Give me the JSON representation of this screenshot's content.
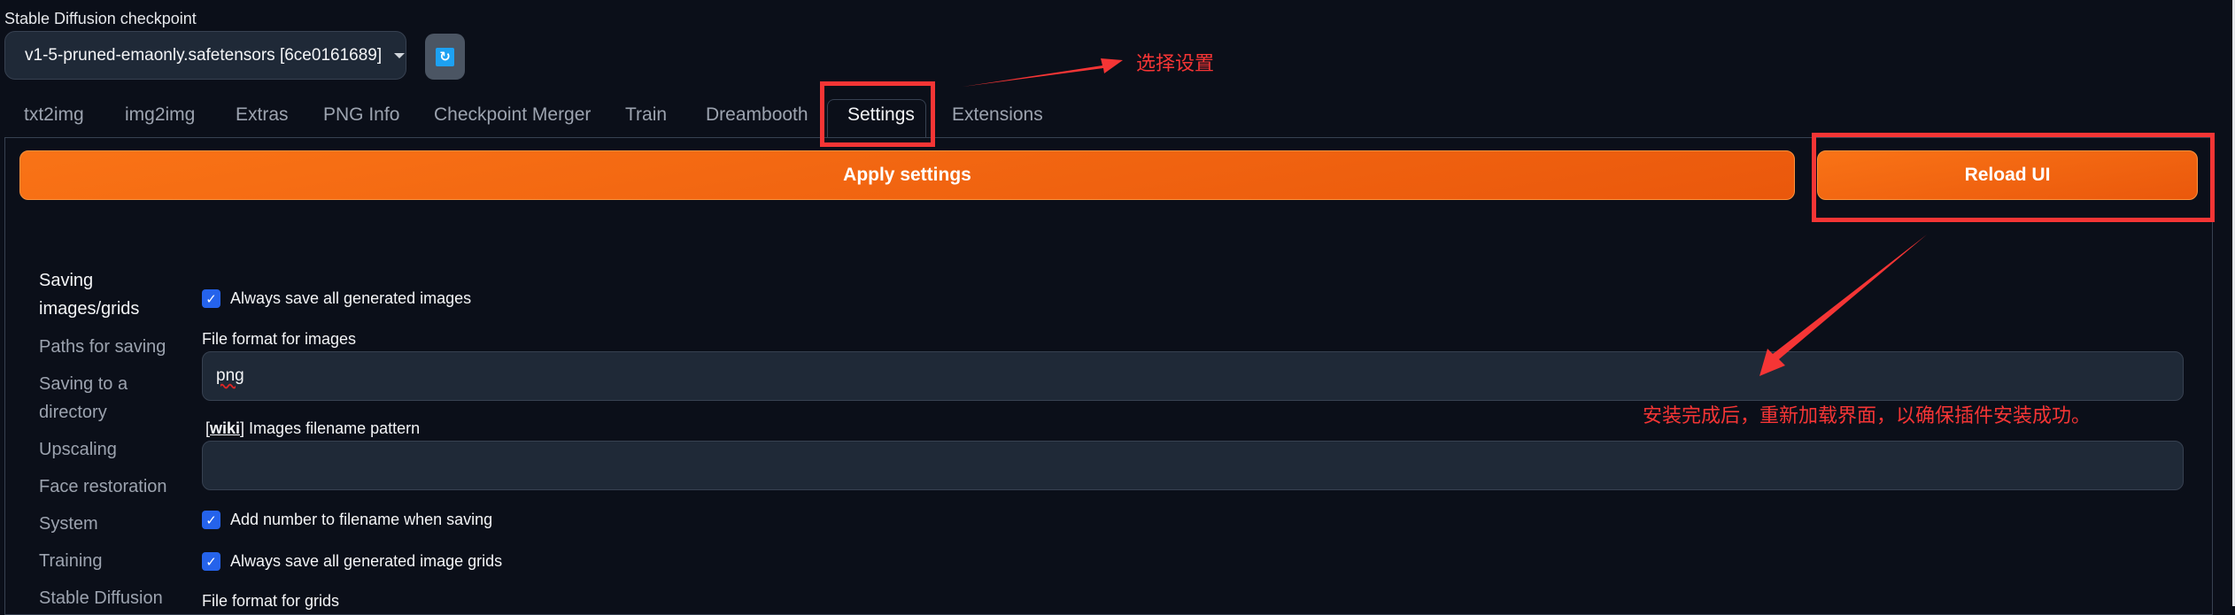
{
  "checkpoint": {
    "label": "Stable Diffusion checkpoint",
    "selected": "v1-5-pruned-emaonly.safetensors [6ce0161689]",
    "refresh_icon": "refresh-icon"
  },
  "tabs": [
    {
      "label": "txt2img",
      "active": false
    },
    {
      "label": "img2img",
      "active": false
    },
    {
      "label": "Extras",
      "active": false
    },
    {
      "label": "PNG Info",
      "active": false
    },
    {
      "label": "Checkpoint Merger",
      "active": false
    },
    {
      "label": "Train",
      "active": false
    },
    {
      "label": "Dreambooth",
      "active": false
    },
    {
      "label": "Settings",
      "active": true
    },
    {
      "label": "Extensions",
      "active": false
    }
  ],
  "actions": {
    "apply_label": "Apply settings",
    "reload_label": "Reload UI"
  },
  "sidebar": {
    "items": [
      {
        "label": "Saving images/grids",
        "active": true
      },
      {
        "label": "Paths for saving",
        "active": false
      },
      {
        "label": "Saving to a directory",
        "active": false
      },
      {
        "label": "Upscaling",
        "active": false
      },
      {
        "label": "Face restoration",
        "active": false
      },
      {
        "label": "System",
        "active": false
      },
      {
        "label": "Training",
        "active": false
      },
      {
        "label": "Stable Diffusion",
        "active": false
      }
    ]
  },
  "settings": {
    "always_save_images": {
      "label": "Always save all generated images",
      "checked": true
    },
    "file_format_images": {
      "label": "File format for images",
      "value": "png"
    },
    "filename_pattern": {
      "wiki": "wiki",
      "label": "Images filename pattern",
      "value": ""
    },
    "add_number": {
      "label": "Add number to filename when saving",
      "checked": true
    },
    "always_save_grids": {
      "label": "Always save all generated image grids",
      "checked": true
    },
    "file_format_grids": {
      "label": "File format for grids"
    }
  },
  "annotations": {
    "select_settings": "选择设置",
    "reload_note": "安装完成后，重新加载界面，以确保插件安装成功。",
    "color": "#f53535"
  },
  "theme": {
    "accent": "#f97316",
    "background": "#0b0f19",
    "checkbox": "#2563eb"
  }
}
